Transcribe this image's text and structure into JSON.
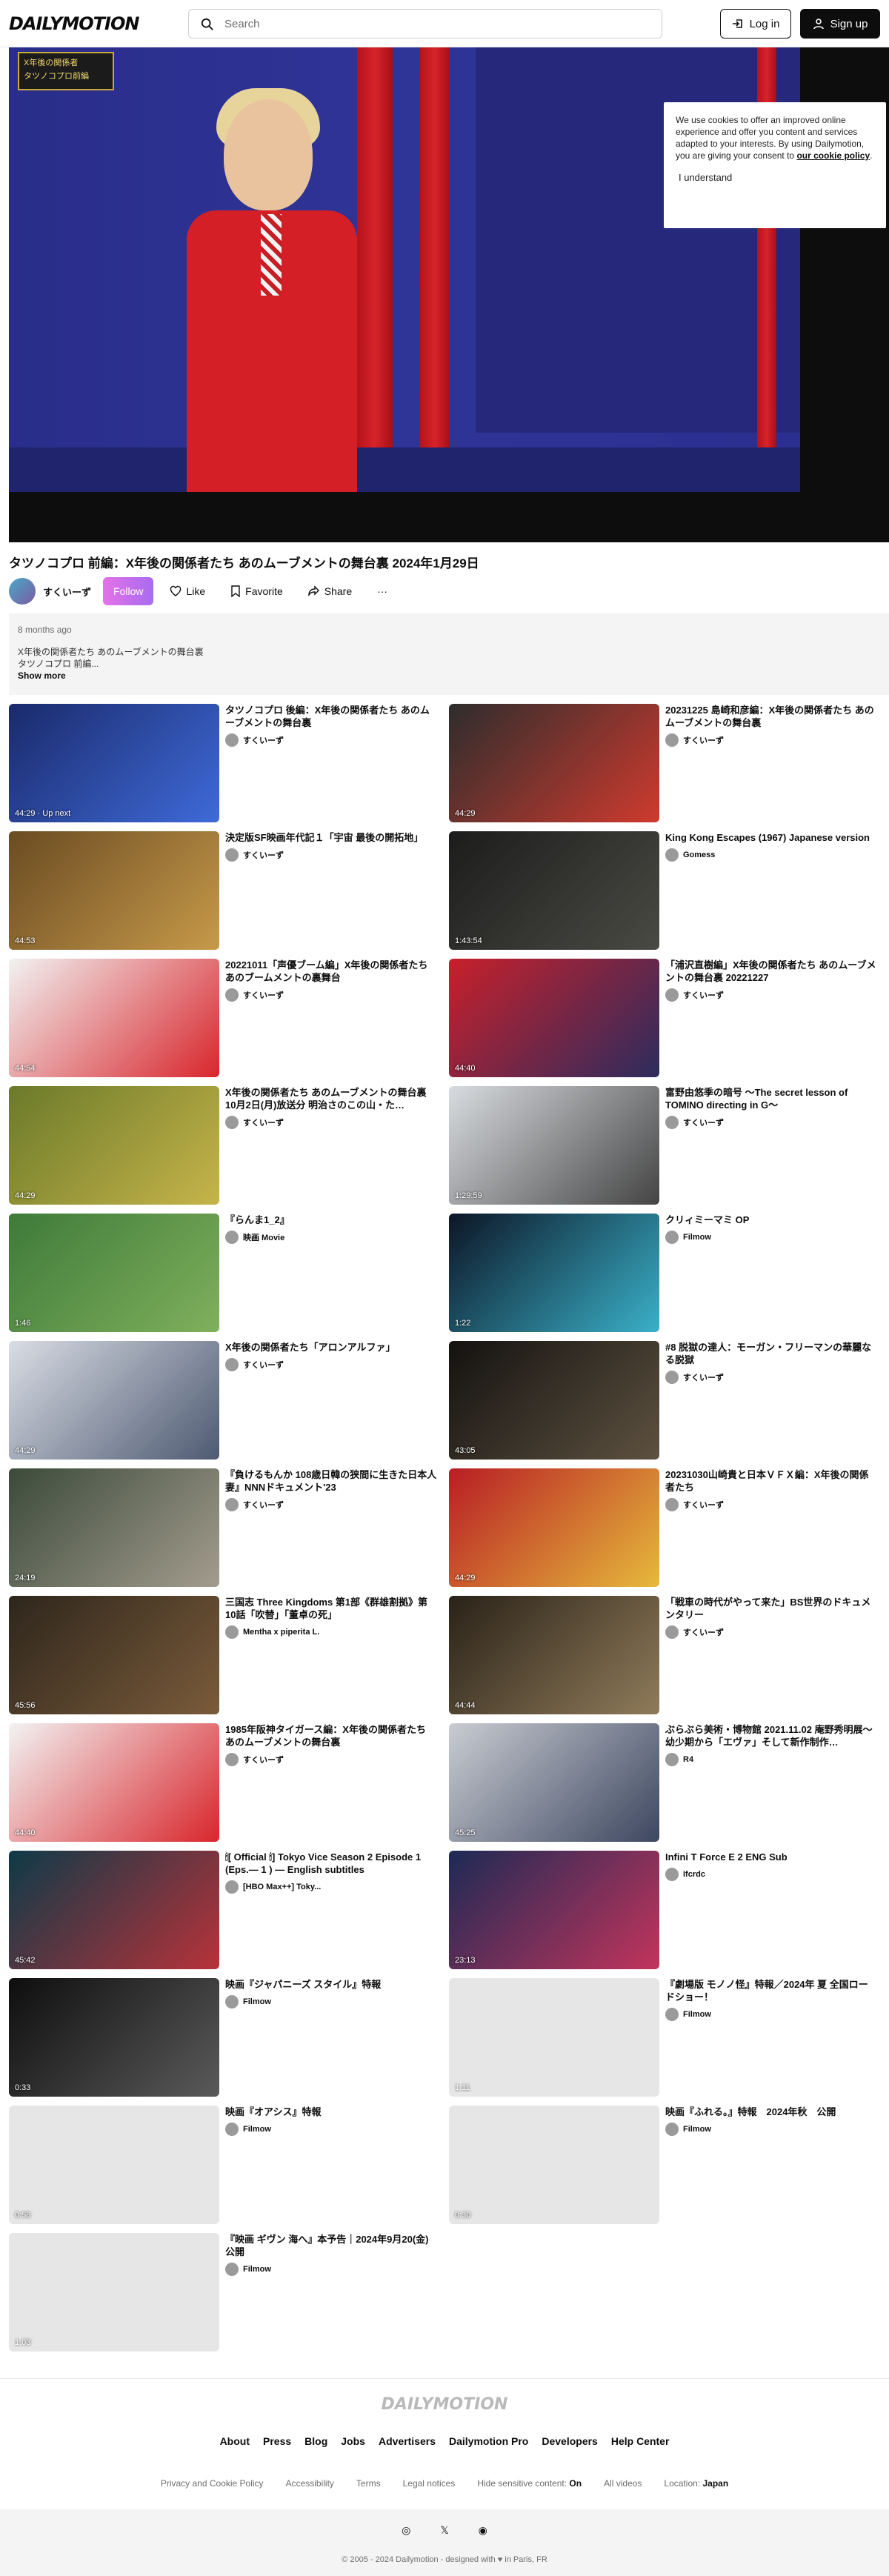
{
  "header": {
    "logo": "DAILYMOTION",
    "search_placeholder": "Search",
    "login_label": "Log in",
    "signup_label": "Sign up"
  },
  "player": {
    "badge_line1": "X年後の関係者",
    "badge_line2": "タツノコプロ前編",
    "cookie": {
      "text_before": "We use cookies to offer an improved online experience and offer you content and services adapted to your interests. By using Dailymotion, you are giving your consent to ",
      "link": "our cookie policy",
      "text_after": ".",
      "button": "I understand"
    }
  },
  "video": {
    "title": "タツノコプロ 前編：X年後の関係者たち あのムーブメントの舞台裏 2024年1月29日",
    "channel": "すくいーず",
    "follow": "Follow",
    "like": "Like",
    "favorite": "Favorite",
    "share": "Share",
    "more": "···",
    "ago": "8 months ago",
    "desc_line1": "X年後の関係者たち あのムーブメントの舞台裏",
    "desc_line2": "タツノコプロ 前編...",
    "show_more": "Show more"
  },
  "cards": [
    {
      "title": "タツノコプロ 後編：X年後の関係者たち あのムーブメントの舞台裏",
      "owner": "すくいーず",
      "duration": "44:29 · Up next",
      "thumb": "#1a2a6b",
      "thumb2": "#3f6ad8"
    },
    {
      "title": "20231225 島崎和彦編：X年後の関係者たち あのムーブメントの舞台裏",
      "owner": "すくいーず",
      "duration": "44:29",
      "thumb": "#2d2d2d",
      "thumb2": "#cf3a2e"
    },
    {
      "title": "決定版SF映画年代記１「宇宙 最後の開拓地」",
      "owner": "すくいーず",
      "duration": "44:53",
      "thumb": "#6a4b22",
      "thumb2": "#c79a4a"
    },
    {
      "title": "King Kong Escapes (1967) Japanese version",
      "owner": "Gomess",
      "duration": "1:43:54",
      "thumb": "#1c1c1c",
      "thumb2": "#4a4a44"
    },
    {
      "title": "20221011「声優ブーム編」X年後の関係者たち あのブームメントの裏舞台",
      "owner": "すくいーず",
      "duration": "44:54",
      "thumb": "#f2f2f2",
      "thumb2": "#d8262c"
    },
    {
      "title": "「浦沢直樹編」X年後の関係者たち あのムーブメントの舞台裏 20221227",
      "owner": "すくいーず",
      "duration": "44:40",
      "thumb": "#c8202a",
      "thumb2": "#2c2c5e"
    },
    {
      "title": "X年後の関係者たち あのムーブメントの舞台裏 10月2日(月)放送分 明治さのこの山・た…",
      "owner": "すくいーず",
      "duration": "44:29",
      "thumb": "#6b7a2a",
      "thumb2": "#c6b44a"
    },
    {
      "title": "富野由悠季の暗号 〜The secret lesson of TOMINO directing in G〜",
      "owner": "すくいーず",
      "duration": "1:29:59",
      "thumb": "#d9dce0",
      "thumb2": "#444"
    },
    {
      "title": "『らんま1_2』",
      "owner": "映画 Movie",
      "duration": "1:46",
      "thumb": "#3f7a3a",
      "thumb2": "#7fb05c"
    },
    {
      "title": "クリィミーマミ OP",
      "owner": "Filmow",
      "duration": "1:22",
      "thumb": "#0c1626",
      "thumb2": "#3ab0c8"
    },
    {
      "title": "X年後の関係者たち「アロンアルファ」",
      "owner": "すくいーず",
      "duration": "44:29",
      "thumb": "#d9dde4",
      "thumb2": "#4e5a72"
    },
    {
      "title": "#8 脱獄の達人：モーガン・フリーマンの華麗なる脱獄",
      "owner": "すくいーず",
      "duration": "43:05",
      "thumb": "#141210",
      "thumb2": "#5d5140"
    },
    {
      "title": "『負けるもんか 108歳日韓の狭間に生きた日本人妻』NNNドキュメント'23",
      "owner": "すくいーず",
      "duration": "24:19",
      "thumb": "#3b4a3a",
      "thumb2": "#a39c8e"
    },
    {
      "title": "20231030山崎貴と日本ＶＦＸ編：X年後の関係者たち",
      "owner": "すくいーず",
      "duration": "44:29",
      "thumb": "#b81e24",
      "thumb2": "#e6b93c"
    },
    {
      "title": "三国志 Three Kingdoms 第1部《群雄割拠》第10話「吹替」「董卓の死」",
      "owner": "Mentha x piperita L.",
      "duration": "45:56",
      "thumb": "#2e261c",
      "thumb2": "#7a5b3a"
    },
    {
      "title": "「戦車の時代がやって来た」BS世界のドキュメンタリー",
      "owner": "すくいーず",
      "duration": "44:44",
      "thumb": "#2a2218",
      "thumb2": "#8f7b5a"
    },
    {
      "title": "1985年阪神タイガース編：X年後の関係者たち あのムーブメントの舞台裏",
      "owner": "すくいーず",
      "duration": "44:40",
      "thumb": "#f3f3f3",
      "thumb2": "#d8262c"
    },
    {
      "title": "ぶらぶら美術・博物館 2021.11.02 庵野秀明展〜幼少期から「エヴァ」そして新作制作…",
      "owner": "R4",
      "duration": "45:25",
      "thumb": "#c9ccd2",
      "thumb2": "#3d4760"
    },
    {
      "title": "🕯[ Official 🕯] Tokyo Vice Season 2 Episode 1 (Eps.— 1 ) — English subtitles",
      "owner": "[HBO Max++] Toky...",
      "duration": "45:42",
      "thumb": "#0d3a48",
      "thumb2": "#b8323a"
    },
    {
      "title": "Infini T Force E 2 ENG Sub",
      "owner": "Ifcrdc",
      "duration": "23:13",
      "thumb": "#1d2a55",
      "thumb2": "#c2345c"
    },
    {
      "title": "映画『ジャパニーズ スタイル』特報",
      "owner": "Filmow",
      "duration": "0:33",
      "thumb": "#0e0e0e",
      "thumb2": "#5a5a5a"
    },
    {
      "title": "『劇場版 モノノ怪』特報／2024年 夏 全国ロードショー！",
      "owner": "Filmow",
      "duration": "1:11",
      "thumb": "#e6e6e6",
      "thumb2": "#e6e6e6"
    },
    {
      "title": "映画『オアシス』特報",
      "owner": "Filmow",
      "duration": "0:58",
      "thumb": "#e6e6e6",
      "thumb2": "#e6e6e6"
    },
    {
      "title": "映画『ふれる。』特報　2024年秋　公開",
      "owner": "Filmow",
      "duration": "0:30",
      "thumb": "#e6e6e6",
      "thumb2": "#e6e6e6"
    },
    {
      "title": "『映画 ギヴン 海へ』本予告｜2024年9月20(金)公開",
      "owner": "Filmow",
      "duration": "1:03",
      "thumb": "#e6e6e6",
      "thumb2": "#e6e6e6"
    }
  ],
  "footer": {
    "logo": "DAILYMOTION",
    "links": [
      "About",
      "Press",
      "Blog",
      "Jobs",
      "Advertisers",
      "Dailymotion Pro",
      "Developers",
      "Help Center"
    ],
    "sub": {
      "privacy": "Privacy and Cookie Policy",
      "accessibility": "Accessibility",
      "terms": "Terms",
      "legal": "Legal notices",
      "sensitive_label": "Hide sensitive content:",
      "sensitive_value": "On",
      "all_videos": "All videos",
      "location_label": "Location:",
      "location_value": "Japan"
    },
    "social": [
      "◎",
      "𝕏",
      "◉"
    ],
    "copyright": "© 2005 - 2024 Dailymotion - designed with ♥ in Paris, FR"
  }
}
